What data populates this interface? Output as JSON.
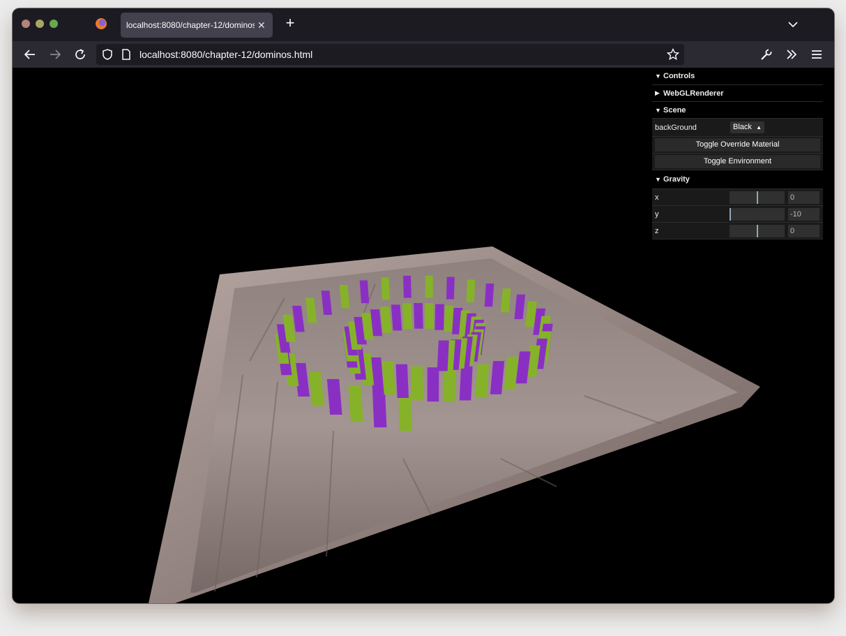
{
  "browser": {
    "tab_title": "localhost:8080/chapter-12/dominos.html",
    "tab_close": "✕",
    "new_tab": "+",
    "url": "localhost:8080/chapter-12/dominos.html"
  },
  "gui": {
    "title": "Controls",
    "folders": {
      "renderer": "WebGLRenderer",
      "scene": "Scene",
      "gravity": "Gravity"
    },
    "scene": {
      "background_label": "backGround",
      "background_value": "Black",
      "toggle_override": "Toggle Override Material",
      "toggle_env": "Toggle Environment"
    },
    "gravity": {
      "x_label": "x",
      "x_value": "0",
      "x_level": 0.5,
      "y_label": "y",
      "y_value": "-10",
      "y_level": 0.0,
      "z_label": "z",
      "z_value": "0",
      "z_level": 0.5
    }
  },
  "colors": {
    "domino_green": "#86b22a",
    "domino_purple": "#8a2fc4",
    "board": "#8f7e79",
    "rim": "#a08f8b"
  }
}
